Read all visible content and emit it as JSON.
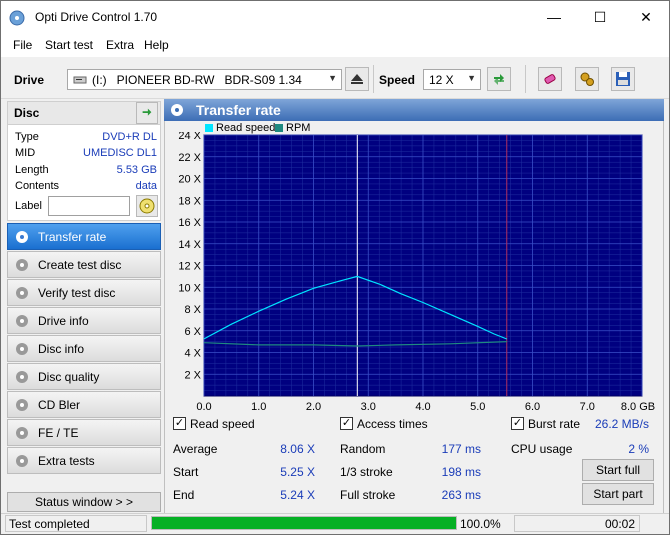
{
  "window": {
    "title": "Opti Drive Control 1.70",
    "minimize": "—",
    "maximize": "☐",
    "close": "✕"
  },
  "menu": [
    "File",
    "Start test",
    "Extra",
    "Help"
  ],
  "toolbar": {
    "drive_label": "Drive",
    "drive_value": "(I:)   PIONEER BD-RW   BDR-S09 1.34",
    "speed_label": "Speed",
    "speed_value": "12 X"
  },
  "disc": {
    "header": "Disc",
    "rows": [
      {
        "key": "Type",
        "value": "DVD+R DL"
      },
      {
        "key": "MID",
        "value": "UMEDISC DL1"
      },
      {
        "key": "Length",
        "value": "5.53 GB"
      },
      {
        "key": "Contents",
        "value": "data"
      }
    ],
    "label_key": "Label",
    "label_value": ""
  },
  "nav": [
    {
      "label": "Transfer rate",
      "active": true
    },
    {
      "label": "Create test disc",
      "active": false
    },
    {
      "label": "Verify test disc",
      "active": false
    },
    {
      "label": "Drive info",
      "active": false
    },
    {
      "label": "Disc info",
      "active": false
    },
    {
      "label": "Disc quality",
      "active": false
    },
    {
      "label": "CD Bler",
      "active": false
    },
    {
      "label": "FE / TE",
      "active": false
    },
    {
      "label": "Extra tests",
      "active": false
    }
  ],
  "status_window_button": "Status window > >",
  "panel_title": "Transfer rate",
  "chart_data": {
    "type": "line",
    "legend": [
      {
        "name": "Read speed",
        "color": "#00e5ff"
      },
      {
        "name": "RPM",
        "color": "#1f8a80"
      }
    ],
    "x_ticks": [
      "0.0",
      "1.0",
      "2.0",
      "3.0",
      "4.0",
      "5.0",
      "6.0",
      "7.0",
      "8.0 GB"
    ],
    "y_ticks": [
      "2 X",
      "4 X",
      "6 X",
      "8 X",
      "10 X",
      "12 X",
      "14 X",
      "16 X",
      "18 X",
      "20 X",
      "22 X",
      "24 X"
    ],
    "xlim": [
      0,
      8
    ],
    "ylim": [
      0,
      24
    ],
    "grid": true,
    "series": [
      {
        "name": "Read speed",
        "color": "#00e5ff",
        "x": [
          0,
          0.5,
          1.0,
          1.5,
          2.0,
          2.5,
          2.8,
          3.2,
          3.6,
          4.0,
          4.5,
          5.0,
          5.3,
          5.53
        ],
        "y": [
          5.25,
          6.6,
          7.8,
          8.9,
          9.9,
          10.6,
          11.0,
          10.3,
          9.4,
          8.6,
          7.5,
          6.4,
          5.7,
          5.24
        ]
      },
      {
        "name": "RPM",
        "color": "#1f8a80",
        "x": [
          0,
          1,
          2,
          2.8,
          3.5,
          4.5,
          5.53
        ],
        "y": [
          4.9,
          4.7,
          4.7,
          4.6,
          4.7,
          4.8,
          5.0
        ]
      }
    ],
    "markers": [
      {
        "x": 2.8,
        "color": "#ffffff"
      },
      {
        "x": 5.53,
        "color": "#b03060"
      }
    ]
  },
  "results": {
    "read_speed_label": "Read speed",
    "access_times_label": "Access times",
    "burst_rate_label": "Burst rate",
    "burst_rate_value": "26.2 MB/s",
    "average_label": "Average",
    "average_value": "8.06 X",
    "start_label": "Start",
    "start_value": "5.25 X",
    "end_label": "End",
    "end_value": "5.24 X",
    "random_label": "Random",
    "random_value": "177 ms",
    "third_label": "1/3 stroke",
    "third_value": "198 ms",
    "full_label": "Full stroke",
    "full_value": "263 ms",
    "cpu_label": "CPU usage",
    "cpu_value": "2 %",
    "start_full": "Start full",
    "start_part": "Start part"
  },
  "statusbar": {
    "text": "Test completed",
    "progress": 100,
    "progress_text": "100.0%",
    "time": "00:02"
  }
}
